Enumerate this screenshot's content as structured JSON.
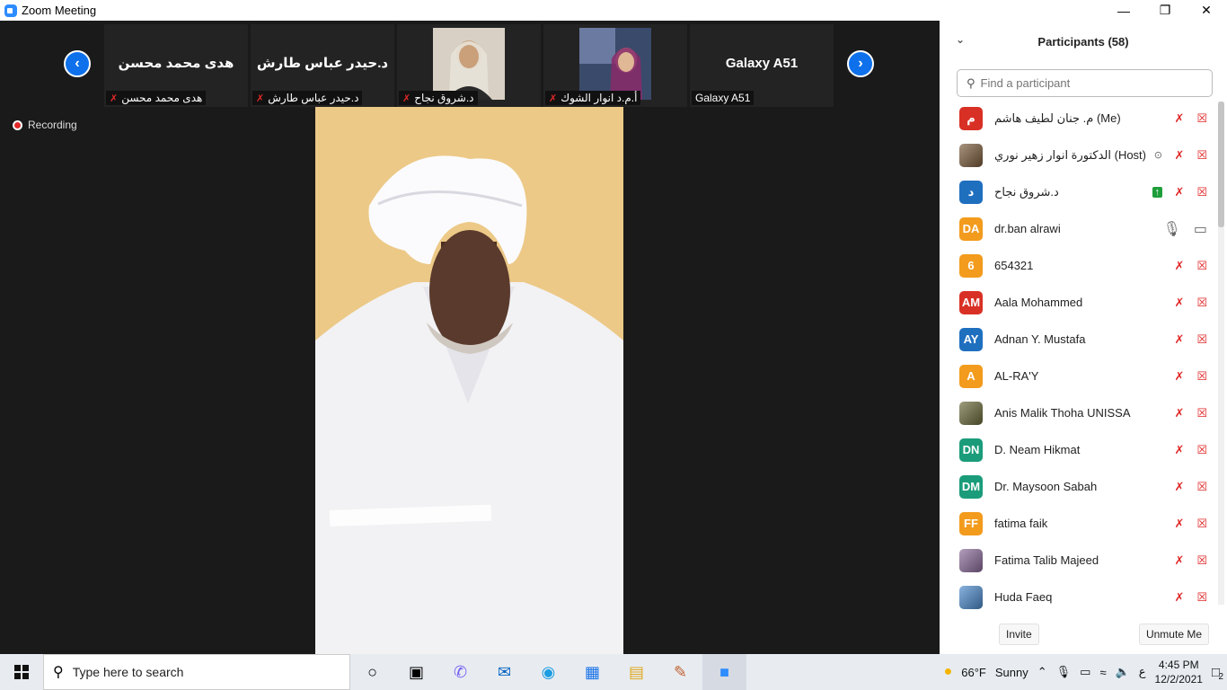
{
  "window": {
    "title": "Zoom Meeting"
  },
  "thumbnails": [
    {
      "display": "هدى محمد محسن",
      "label": "هدى محمد محسن"
    },
    {
      "display": "د.حيدر عباس طارش",
      "label": "د.حيدر عباس طارش"
    },
    {
      "display": "",
      "label": "د.شروق نجاح"
    },
    {
      "display": "",
      "label": "أ.م.د انوار الشوك"
    },
    {
      "display": "Galaxy A51",
      "label": "Galaxy A51"
    }
  ],
  "recording": {
    "label": "Recording"
  },
  "participants": {
    "header": "Participants (58)",
    "search_placeholder": "Find a participant",
    "items": [
      {
        "initials": "م",
        "color": "#d93025",
        "name": "م. جنان لطيف هاشم (Me)"
      },
      {
        "initials": "",
        "color": "#7a5a3a",
        "name": "الدكتورة انوار زهير نوري (Host)"
      },
      {
        "initials": "د",
        "color": "#1f6fbf",
        "name": "د.شروق نجاح"
      },
      {
        "initials": "DA",
        "color": "#f29b1d",
        "name": "dr.ban alrawi"
      },
      {
        "initials": "6",
        "color": "#f29b1d",
        "name": "654321"
      },
      {
        "initials": "AM",
        "color": "#d93025",
        "name": "Aala Mohammed"
      },
      {
        "initials": "AY",
        "color": "#1f6fbf",
        "name": "Adnan Y. Mustafa"
      },
      {
        "initials": "A",
        "color": "#f29b1d",
        "name": "AL-RA'Y"
      },
      {
        "initials": "",
        "color": "#6a6a3a",
        "name": "Anis Malik Thoha UNISSA"
      },
      {
        "initials": "DN",
        "color": "#1a9c7a",
        "name": "D. Neam Hikmat"
      },
      {
        "initials": "DM",
        "color": "#1a9c7a",
        "name": "Dr. Maysoon Sabah"
      },
      {
        "initials": "FF",
        "color": "#f29b1d",
        "name": "fatima faik"
      },
      {
        "initials": "",
        "color": "#8a6a9a",
        "name": "Fatima Talib Majeed"
      },
      {
        "initials": "",
        "color": "#4a8acc",
        "name": "Huda Faeq"
      }
    ],
    "invite": "Invite",
    "unmute": "Unmute Me"
  },
  "taskbar": {
    "search_text": "Type here to search",
    "weather_temp": "66°F",
    "weather_text": "Sunny",
    "lang": "ع",
    "time": "4:45 PM",
    "date": "12/2/2021",
    "notif_count": "2"
  }
}
